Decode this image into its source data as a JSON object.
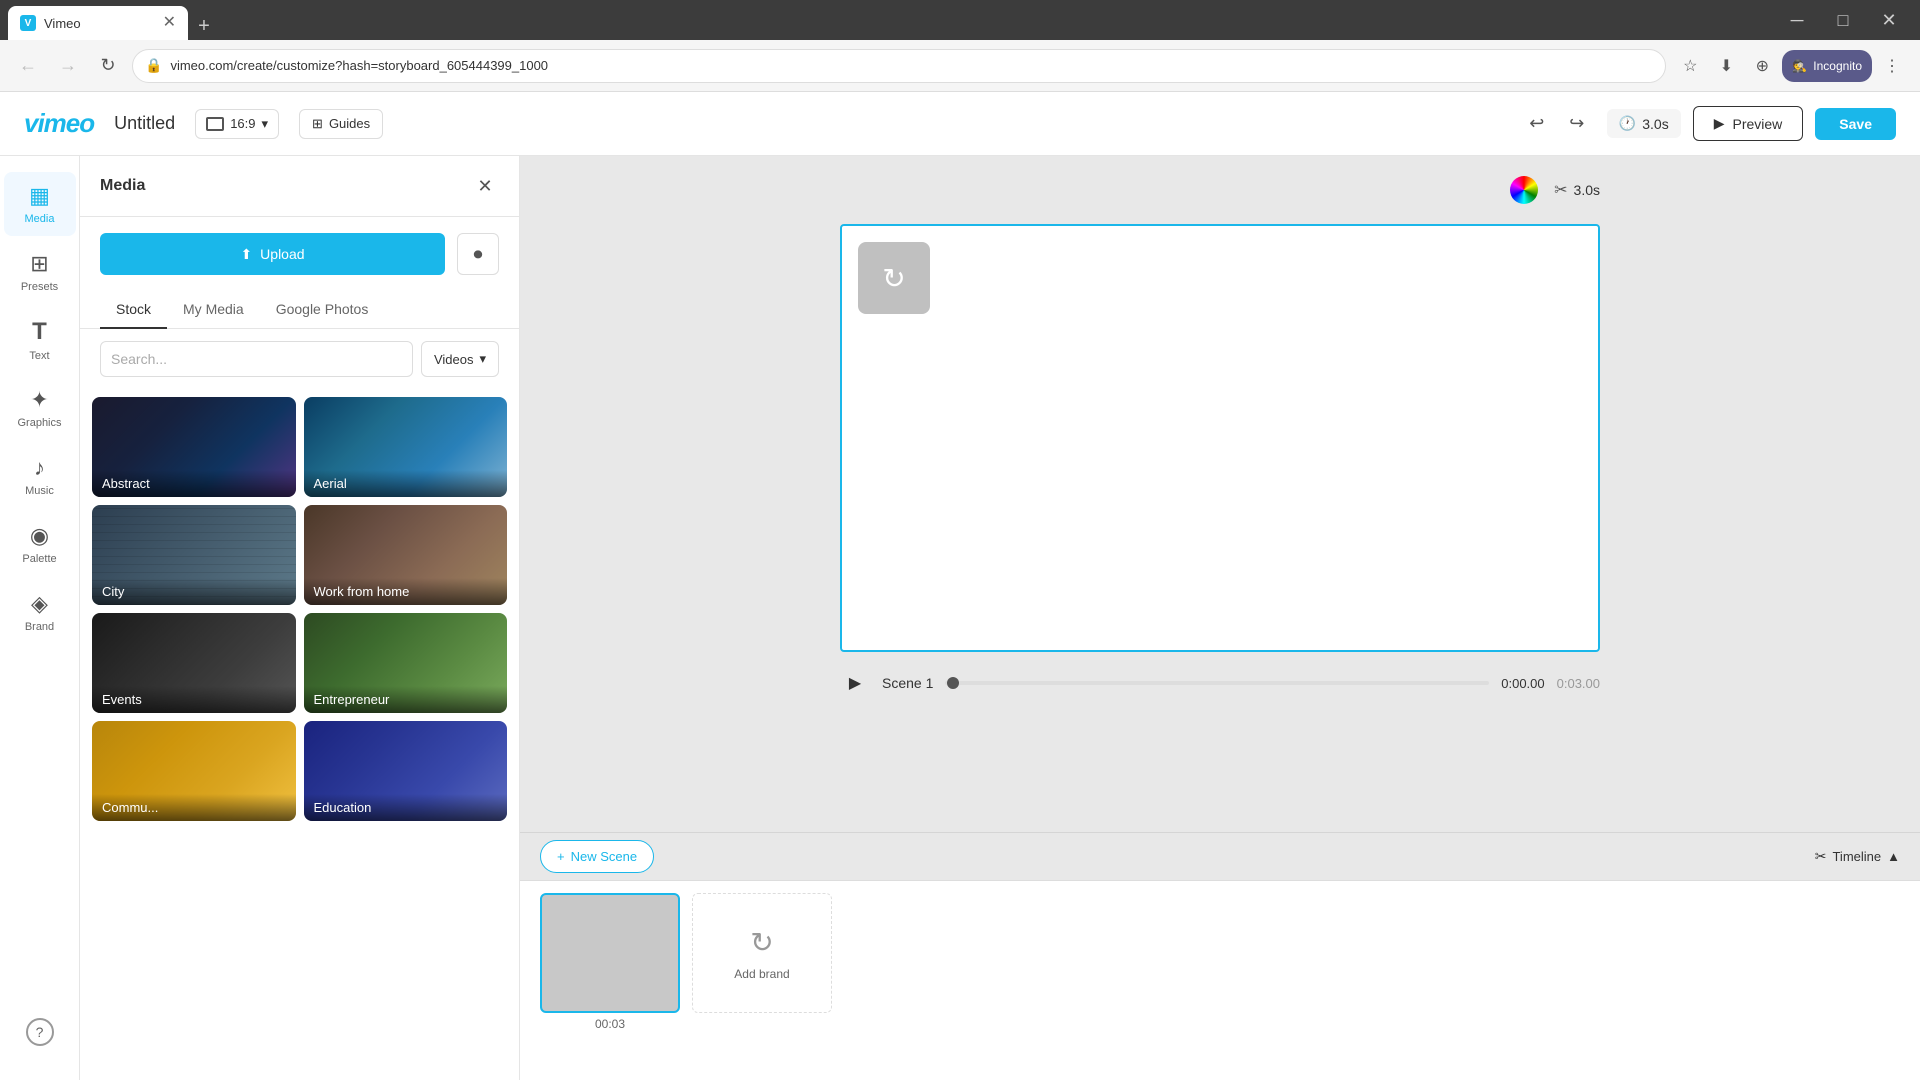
{
  "browser": {
    "tab_favicon": "V",
    "tab_title": "Vimeo",
    "address": "vimeo.com/create/customize?hash=storyboard_605444399_1000",
    "incognito_label": "Incognito",
    "new_tab_icon": "+",
    "back_icon": "←",
    "forward_icon": "→",
    "refresh_icon": "↻",
    "close_icon": "✕",
    "min_icon": "─",
    "max_icon": "□"
  },
  "header": {
    "logo": "vimeo",
    "title": "Untitled",
    "aspect_ratio": "16:9",
    "guides_label": "Guides",
    "undo_icon": "↩",
    "redo_icon": "↪",
    "duration": "3.0s",
    "preview_label": "Preview",
    "save_label": "Save"
  },
  "sidebar": {
    "items": [
      {
        "id": "media",
        "label": "Media",
        "icon": "▦",
        "active": true
      },
      {
        "id": "presets",
        "label": "Presets",
        "icon": "⊞"
      },
      {
        "id": "text",
        "label": "Text",
        "icon": "T"
      },
      {
        "id": "graphics",
        "label": "Graphics",
        "icon": "✦"
      },
      {
        "id": "music",
        "label": "Music",
        "icon": "♪"
      },
      {
        "id": "palette",
        "label": "Palette",
        "icon": "🎨"
      },
      {
        "id": "brand",
        "label": "Brand",
        "icon": "◈"
      },
      {
        "id": "help",
        "label": "",
        "icon": "?"
      }
    ]
  },
  "panel": {
    "title": "Media",
    "upload_label": "Upload",
    "record_icon": "⏺",
    "tabs": [
      "Stock",
      "My Media",
      "Google Photos"
    ],
    "active_tab": "Stock",
    "search_placeholder": "Search...",
    "filter_label": "Videos",
    "media_cards": [
      {
        "id": "abstract",
        "label": "Abstract",
        "class": "abstract-bg"
      },
      {
        "id": "aerial",
        "label": "Aerial",
        "class": "aerial-bg"
      },
      {
        "id": "city",
        "label": "City",
        "class": "city-bg"
      },
      {
        "id": "wfh",
        "label": "Work from home",
        "class": "wfh-bg"
      },
      {
        "id": "events",
        "label": "Events",
        "class": "events-bg"
      },
      {
        "id": "entrepreneur",
        "label": "Entrepreneur",
        "class": "entrepreneur-bg"
      },
      {
        "id": "community",
        "label": "Commu...",
        "class": "community-bg"
      },
      {
        "id": "education",
        "label": "Education",
        "class": "education-bg"
      }
    ]
  },
  "canvas": {
    "placeholder_icon": "↻",
    "scene_label": "Scene 1",
    "time_current": "0:00.00",
    "time_total": "0:03.00",
    "duration_label": "3.0s",
    "cut_label": "3.0s"
  },
  "timeline": {
    "new_scene_label": "+ New Scene",
    "timeline_label": "Timeline",
    "scene_time": "00:03",
    "add_brand_label": "Add brand"
  }
}
